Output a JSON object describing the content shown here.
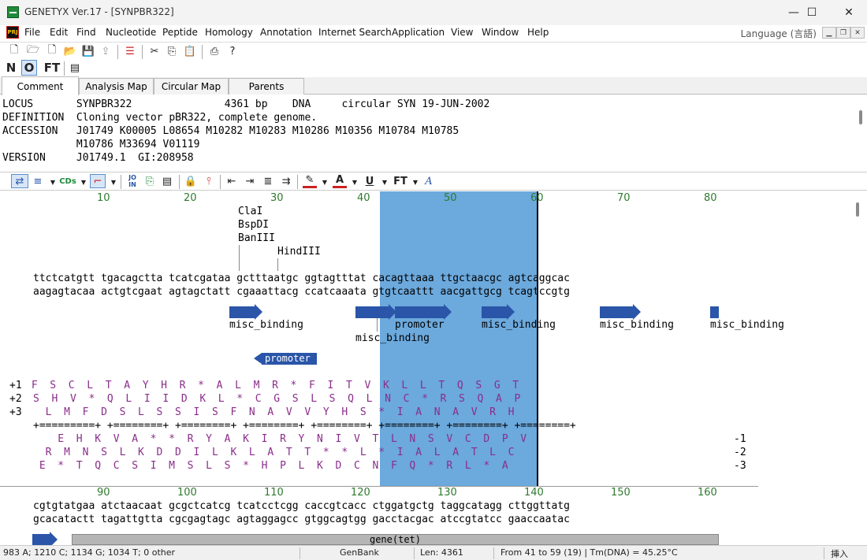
{
  "window": {
    "title": "GENETYX Ver.17 - [SYNPBR322]",
    "minimize": "—",
    "maximize": "☐",
    "close": "✕"
  },
  "menubar": {
    "items": [
      "File",
      "Edit",
      "Find",
      "Nucleotide",
      "Peptide",
      "Homology",
      "Annotation",
      "Internet Search",
      "Application",
      "View",
      "Window",
      "Help"
    ],
    "language": "Language (言語)"
  },
  "toolbar2": {
    "n": "N",
    "o": "O",
    "ft": "FT"
  },
  "tabs": [
    "Comment",
    "Analysis Map",
    "Circular Map",
    "Parents"
  ],
  "comment": {
    "lines": [
      "LOCUS       SYNPBR322               4361 bp    DNA     circular SYN 19-JUN-2002",
      "DEFINITION  Cloning vector pBR322, complete genome.",
      "ACCESSION   J01749 K00005 L08654 M10282 M10283 M10286 M10356 M10784 M10785",
      "            M10786 M33694 V01119",
      "VERSION     J01749.1  GI:208958"
    ]
  },
  "seqtoolbar": {
    "ft": "FT",
    "a": "A"
  },
  "block1": {
    "ruler": [
      "10",
      "20",
      "30",
      "40",
      "50",
      "60",
      "70",
      "80"
    ],
    "enzymes": [
      "ClaI",
      "BspDI",
      "BanIII",
      "HindIII"
    ],
    "top_seq": "ttctcatgtt tgacagctta tcatcgataa gctttaatgc ggtagtttat cacagttaaa ttgctaacgc agtcaggcac",
    "bottom_seq": "aagagtacaa actgtcgaat agtagctatt cgaaattacg ccatcaaata gtgtcaattt aacgattgcg tcagtccgtg",
    "features": [
      "misc_binding",
      "misc_binding",
      "promoter",
      "misc_binding",
      "misc_binding",
      "misc_binding"
    ],
    "reverse_feature": "promoter",
    "frame_labels": [
      "+1",
      "+2",
      "+3",
      "-1",
      "-2",
      "-3"
    ],
    "f1": " F  S  C  L  T  A  Y  H  R  *  A  L  M  R  *  F  I  T  V  K  L  L  T  Q  S  G  T",
    "f2": "S  H  V  *  Q  L  I  I  D  K  L  *  C  G  S  L  S  Q  L  N  C  *  R  S  Q  A  P",
    "f3": "  L  M  F  D  S  L  S  S  I  S  F  N  A  V  V  Y  H  S  *  I  A  N  A  V  R  H",
    "ticks": "+=========+ +========+ +========+ +========+ +========+ +========+ +========+ +========+",
    "r1": "    E  H  K  V  A  *  *  R  Y  A  K  I  R  Y  N  I  V  T  L  N  S  V  C  D  P  V",
    "r2": "  R  M  N  S  L  K  D  D  I  L  K  L  A  T  T  *  *  L  *  I  A  L  A  T  L  C",
    "r3": " E  *  T  Q  C  S  I  M  S  L  S  *  H  P  L  K  D  C  N  F  Q  *  R  L  *  A"
  },
  "block2": {
    "ruler": [
      "90",
      "100",
      "110",
      "120",
      "130",
      "140",
      "150",
      "160"
    ],
    "top_seq": "cgtgtatgaa atctaacaat gcgctcatcg tcatcctcgg caccgtcacc ctggatgctg taggcatagg cttggttatg",
    "bottom_seq": "gcacatactt tagattgtta cgcgagtagc agtaggagcc gtggcagtgg gacctacgac atccgtatcc gaaccaatac",
    "gene_label": "gene(tet)"
  },
  "statusbar": {
    "composition": "983 A; 1210 C; 1134 G; 1034 T; 0 other",
    "format": "GenBank",
    "length": "Len: 4361",
    "selection": "From 41 to 59 (19) | Tm(DNA) = 45.25°C",
    "mode": "挿入"
  },
  "colors": {
    "selection": "#6ca9dd",
    "feature": "#2a55a8",
    "translation": "#8a2d8a",
    "ruler": "#2f7a2f"
  }
}
